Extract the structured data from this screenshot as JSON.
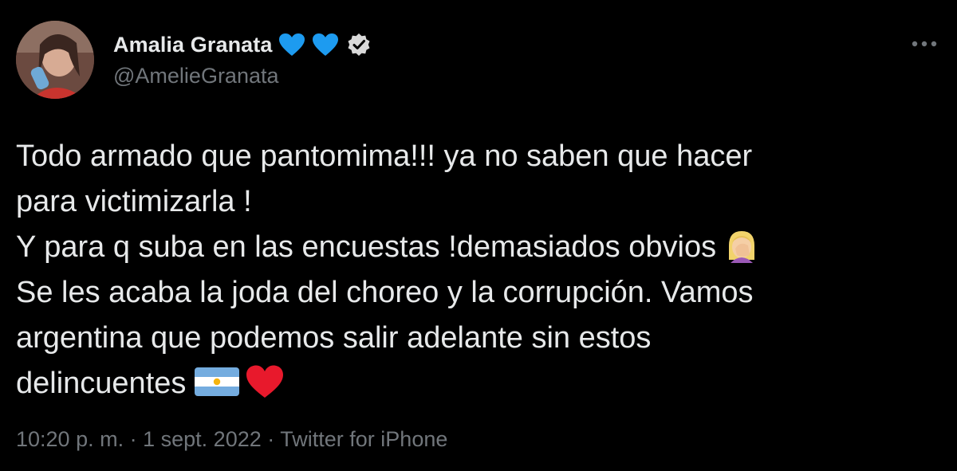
{
  "author": {
    "display_name": "Amalia Granata",
    "handle": "@AmelieGranata",
    "badges": [
      "blue-heart-icon",
      "blue-heart-icon",
      "verified-icon"
    ]
  },
  "tweet": {
    "lines": [
      "Todo armado que pantomima!!! ya no saben que hacer",
      "para victimizarla !",
      "Y para q suba en las encuestas !demasiados obvios",
      "Se les acaba la joda del choreo y la corrupción. Vamos",
      "argentina que podemos salir adelante sin estos",
      "delincuentes"
    ],
    "emojis": [
      "woman-facepalming-emoji",
      "argentina-flag-emoji",
      "red-heart-emoji"
    ]
  },
  "meta": {
    "time": "10:20 p. m.",
    "separator": "·",
    "date": "1 sept. 2022",
    "source": "Twitter for iPhone"
  },
  "colors": {
    "background": "#000000",
    "text": "#e7e9ea",
    "secondary": "#71767b",
    "heart_blue": "#1d9bf0"
  }
}
